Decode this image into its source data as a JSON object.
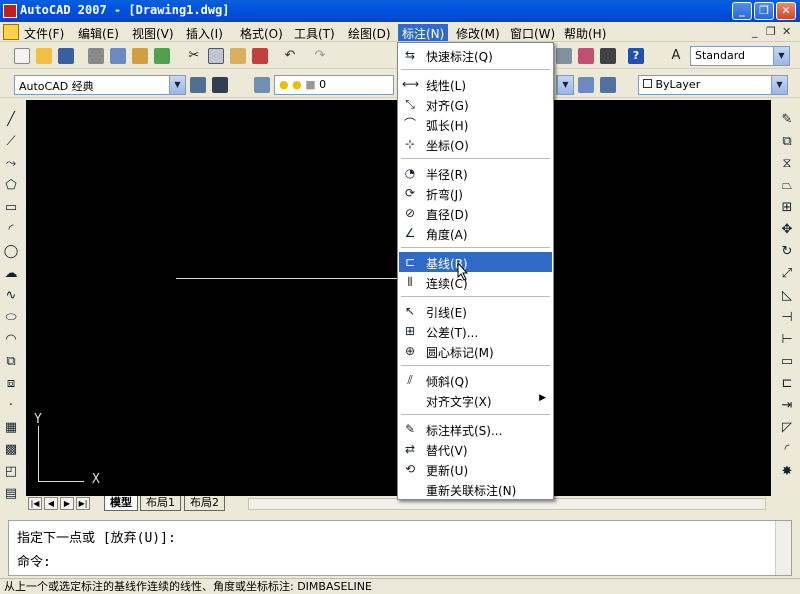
{
  "window": {
    "title": "AutoCAD 2007 - [Drawing1.dwg]",
    "minimize": "_",
    "maximize": "❐",
    "close": "✕"
  },
  "menubar": {
    "items": [
      {
        "label": "文件(F)"
      },
      {
        "label": "编辑(E)"
      },
      {
        "label": "视图(V)"
      },
      {
        "label": "插入(I)"
      },
      {
        "label": "格式(O)"
      },
      {
        "label": "工具(T)"
      },
      {
        "label": "绘图(D)"
      },
      {
        "label": "标注(N)"
      },
      {
        "label": "修改(M)"
      },
      {
        "label": "窗口(W)"
      },
      {
        "label": "帮助(H)"
      }
    ],
    "active_index": 7,
    "doc_controls": [
      "_",
      "❐",
      "✕"
    ]
  },
  "toolbar": {
    "text_style": "Standard",
    "workspace": "AutoCAD 经典",
    "layer": "0",
    "color": "ByLayer"
  },
  "dimension_menu": {
    "items": [
      {
        "label": "快速标注(Q)",
        "icon": "quick-dimension-icon",
        "glyph": "⇆"
      },
      {
        "sep": true
      },
      {
        "label": "线性(L)",
        "icon": "linear-dimension-icon",
        "glyph": "⟷"
      },
      {
        "label": "对齐(G)",
        "icon": "aligned-dimension-icon",
        "glyph": "⤡"
      },
      {
        "label": "弧长(H)",
        "icon": "arc-length-icon",
        "glyph": "⌒"
      },
      {
        "label": "坐标(O)",
        "icon": "ordinate-icon",
        "glyph": "⊹"
      },
      {
        "sep": true
      },
      {
        "label": "半径(R)",
        "icon": "radius-icon",
        "glyph": "◔"
      },
      {
        "label": "折弯(J)",
        "icon": "jogged-icon",
        "glyph": "⟳"
      },
      {
        "label": "直径(D)",
        "icon": "diameter-icon",
        "glyph": "⊘"
      },
      {
        "label": "角度(A)",
        "icon": "angular-icon",
        "glyph": "∠"
      },
      {
        "sep": true
      },
      {
        "label": "基线(B)",
        "icon": "baseline-icon",
        "glyph": "⊏",
        "highlight": true
      },
      {
        "label": "连续(C)",
        "icon": "continue-icon",
        "glyph": "⫴"
      },
      {
        "sep": true
      },
      {
        "label": "引线(E)",
        "icon": "leader-icon",
        "glyph": "↖"
      },
      {
        "label": "公差(T)...",
        "icon": "tolerance-icon",
        "glyph": "⊞"
      },
      {
        "label": "圆心标记(M)",
        "icon": "center-mark-icon",
        "glyph": "⊕"
      },
      {
        "sep": true
      },
      {
        "label": "倾斜(Q)",
        "icon": "oblique-icon",
        "glyph": "⫽"
      },
      {
        "label": "对齐文字(X)",
        "icon": "",
        "glyph": "",
        "submenu": true
      },
      {
        "sep": true
      },
      {
        "label": "标注样式(S)...",
        "icon": "dimension-style-icon",
        "glyph": "✎"
      },
      {
        "label": "替代(V)",
        "icon": "override-icon",
        "glyph": "⇄"
      },
      {
        "label": "更新(U)",
        "icon": "update-icon",
        "glyph": "⟲"
      },
      {
        "label": "重新关联标注(N)",
        "icon": "",
        "glyph": ""
      }
    ]
  },
  "layout_tabs": {
    "nav": [
      "|◀",
      "◀",
      "▶",
      "▶|"
    ],
    "tabs": [
      "模型",
      "布局1",
      "布局2"
    ],
    "active_index": 0
  },
  "command": {
    "line1": "指定下一点或 [放弃(U)]:",
    "line2": "命令:"
  },
  "ucs": {
    "x": "X",
    "y": "Y"
  },
  "status_text": "从上一个或选定标注的基线作连续的线性、角度或坐标标注:  DIMBASELINE"
}
